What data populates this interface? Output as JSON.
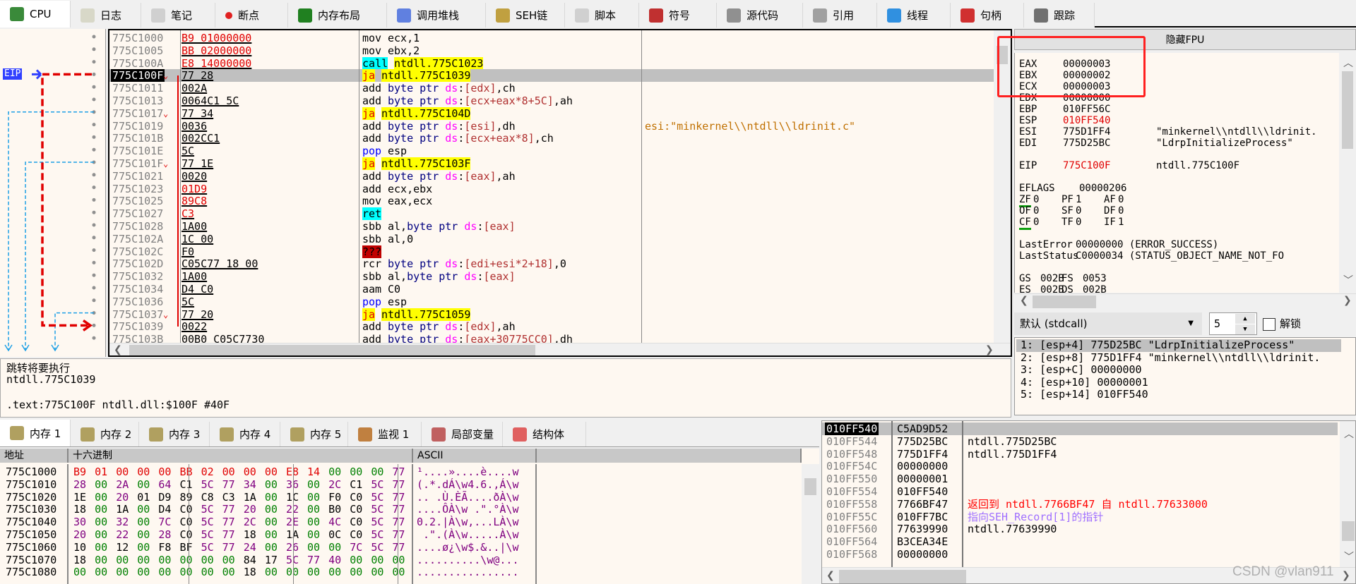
{
  "tabs": [
    {
      "label": "CPU",
      "icon": "cpu-icon",
      "active": true
    },
    {
      "label": "日志",
      "icon": "log-icon"
    },
    {
      "label": "笔记",
      "icon": "notes-icon"
    },
    {
      "label": "断点",
      "icon": "breakpoint-icon"
    },
    {
      "label": "内存布局",
      "icon": "memory-map-icon"
    },
    {
      "label": "调用堆栈",
      "icon": "call-stack-icon"
    },
    {
      "label": "SEH链",
      "icon": "seh-icon"
    },
    {
      "label": "脚本",
      "icon": "script-icon"
    },
    {
      "label": "符号",
      "icon": "symbol-icon"
    },
    {
      "label": "源代码",
      "icon": "source-icon"
    },
    {
      "label": "引用",
      "icon": "references-icon"
    },
    {
      "label": "线程",
      "icon": "threads-icon"
    },
    {
      "label": "句柄",
      "icon": "handles-icon"
    },
    {
      "label": "跟踪",
      "icon": "trace-icon"
    }
  ],
  "eip_label": "EIP",
  "colors": {
    "changed_bytes": "#e00000",
    "jump_highlight": "#ffff00",
    "call_highlight": "#00ffff",
    "highlight_box": "#ff2020",
    "eip_arrow": "#e00000",
    "jump_lines": "#1ea0e6"
  },
  "disasm": [
    {
      "addr": "775C1000",
      "bytes": "B9 01000000",
      "mnem": "mov",
      "ops": "ecx,1",
      "changed": true
    },
    {
      "addr": "775C1005",
      "bytes": "BB 02000000",
      "mnem": "mov",
      "ops": "ebx,2",
      "changed": true
    },
    {
      "addr": "775C100A",
      "bytes": "E8 14000000",
      "mnem": "call",
      "ops": "ntdll.775C1023",
      "changed": true,
      "kind": "call"
    },
    {
      "addr": "775C100F",
      "bytes": "77 28",
      "mnem": "ja",
      "ops": "ntdll.775C1039",
      "kind": "jump",
      "eip": true
    },
    {
      "addr": "775C1011",
      "bytes": "002A",
      "mnem": "add",
      "ops": "byte ptr ds:[edx],ch"
    },
    {
      "addr": "775C1013",
      "bytes": "0064C1 5C",
      "mnem": "add",
      "ops": "byte ptr ds:[ecx+eax*8+5C],ah"
    },
    {
      "addr": "775C1017",
      "bytes": "77 34",
      "mnem": "ja",
      "ops": "ntdll.775C104D",
      "kind": "jump"
    },
    {
      "addr": "775C1019",
      "bytes": "0036",
      "mnem": "add",
      "ops": "byte ptr ds:[esi],dh",
      "comment": "esi:\"minkernel\\\\ntdll\\\\ldrinit.c\""
    },
    {
      "addr": "775C101B",
      "bytes": "002CC1",
      "mnem": "add",
      "ops": "byte ptr ds:[ecx+eax*8],ch"
    },
    {
      "addr": "775C101E",
      "bytes": "5C",
      "mnem": "pop",
      "ops": "esp",
      "kind": "pop"
    },
    {
      "addr": "775C101F",
      "bytes": "77 1E",
      "mnem": "ja",
      "ops": "ntdll.775C103F",
      "kind": "jump"
    },
    {
      "addr": "775C1021",
      "bytes": "0020",
      "mnem": "add",
      "ops": "byte ptr ds:[eax],ah"
    },
    {
      "addr": "775C1023",
      "bytes": "01D9",
      "mnem": "add",
      "ops": "ecx,ebx",
      "changed": true
    },
    {
      "addr": "775C1025",
      "bytes": "89C8",
      "mnem": "mov",
      "ops": "eax,ecx",
      "changed": true
    },
    {
      "addr": "775C1027",
      "bytes": "C3",
      "mnem": "ret",
      "ops": "",
      "changed": true,
      "kind": "ret"
    },
    {
      "addr": "775C1028",
      "bytes": "1A00",
      "mnem": "sbb",
      "ops": "al,byte ptr ds:[eax]"
    },
    {
      "addr": "775C102A",
      "bytes": "1C 00",
      "mnem": "sbb",
      "ops": "al,0"
    },
    {
      "addr": "775C102C",
      "bytes": "F0",
      "mnem": "???",
      "ops": "",
      "kind": "bad"
    },
    {
      "addr": "775C102D",
      "bytes": "C05C77 18 00",
      "mnem": "rcr",
      "ops": "byte ptr ds:[edi+esi*2+18],0"
    },
    {
      "addr": "775C1032",
      "bytes": "1A00",
      "mnem": "sbb",
      "ops": "al,byte ptr ds:[eax]"
    },
    {
      "addr": "775C1034",
      "bytes": "D4 C0",
      "mnem": "aam",
      "ops": "C0"
    },
    {
      "addr": "775C1036",
      "bytes": "5C",
      "mnem": "pop",
      "ops": "esp",
      "kind": "pop"
    },
    {
      "addr": "775C1037",
      "bytes": "77 20",
      "mnem": "ja",
      "ops": "ntdll.775C1059",
      "kind": "jump"
    },
    {
      "addr": "775C1039",
      "bytes": "0022",
      "mnem": "add",
      "ops": "byte ptr ds:[edx],ah"
    },
    {
      "addr": "775C103B",
      "bytes": "00B0 C05C7730",
      "mnem": "add",
      "ops": "byte ptr ds:[eax+30775CC0],dh"
    }
  ],
  "registers": {
    "hide_fpu_label": "隐藏FPU",
    "lines": [
      {
        "name": "EAX",
        "value": "00000003"
      },
      {
        "name": "EBX",
        "value": "00000002"
      },
      {
        "name": "ECX",
        "value": "00000003"
      },
      {
        "name": "EDX",
        "value": "00000000"
      },
      {
        "name": "EBP",
        "value": "010FF56C"
      },
      {
        "name": "ESP",
        "value": "010FF540",
        "changed": true
      },
      {
        "name": "ESI",
        "value": "775D1FF4",
        "comment": "\"minkernel\\\\ntdll\\\\ldrinit."
      },
      {
        "name": "EDI",
        "value": "775D25BC",
        "comment": "\"LdrpInitializeProcess\""
      },
      {},
      {
        "name": "EIP",
        "value": "775C100F",
        "changed": true,
        "comment": "ntdll.775C100F"
      },
      {},
      {
        "name": "EFLAGS",
        "value": "00000206"
      },
      {
        "flags": [
          [
            "ZF",
            "0"
          ],
          [
            "PF",
            "1"
          ],
          [
            "AF",
            "0"
          ]
        ]
      },
      {
        "flags": [
          [
            "OF",
            "0"
          ],
          [
            "SF",
            "0"
          ],
          [
            "DF",
            "0"
          ]
        ]
      },
      {
        "flags": [
          [
            "CF",
            "0"
          ],
          [
            "TF",
            "0"
          ],
          [
            "IF",
            "1"
          ]
        ]
      },
      {},
      {
        "name": "LastError",
        "value": "00000000 (ERROR_SUCCESS)"
      },
      {
        "name": "LastStatus",
        "value": "C0000034 (STATUS_OBJECT_NAME_NOT_FO"
      },
      {},
      {
        "flags": [
          [
            "GS",
            "002B"
          ],
          [
            "FS",
            "0053"
          ]
        ]
      },
      {
        "flags": [
          [
            "ES",
            "002B"
          ],
          [
            "DS",
            "002B"
          ]
        ]
      }
    ]
  },
  "callconv": {
    "selected": "默认 (stdcall)",
    "arg_count": "5",
    "unlock_label": "解锁",
    "unlocked": false
  },
  "args": [
    "1: [esp+4] 775D25BC \"LdrpInitializeProcess\"",
    "2: [esp+8] 775D1FF4 \"minkernel\\\\ntdll\\\\ldrinit.",
    "3: [esp+C] 00000000",
    "4: [esp+10] 00000001",
    "5: [esp+14] 010FF540"
  ],
  "info": {
    "line1": "跳转将要执行",
    "line2": "ntdll.775C1039",
    "line3": ".text:775C100F ntdll.dll:$100F #40F"
  },
  "bottom_tabs": [
    {
      "label": "内存 1",
      "icon": "memory-icon",
      "active": true
    },
    {
      "label": "内存 2",
      "icon": "memory-icon"
    },
    {
      "label": "内存 3",
      "icon": "memory-icon"
    },
    {
      "label": "内存 4",
      "icon": "memory-icon"
    },
    {
      "label": "内存 5",
      "icon": "memory-icon"
    },
    {
      "label": "监视 1",
      "icon": "watch-icon"
    },
    {
      "label": "局部变量",
      "icon": "locals-icon"
    },
    {
      "label": "结构体",
      "icon": "struct-icon"
    }
  ],
  "dump": {
    "headers": {
      "addr": "地址",
      "hex": "十六进制",
      "ascii": "ASCII"
    },
    "rows": [
      {
        "addr": "775C1000",
        "hex": "B9 01 00 00 00 BB 02 00 00 00 E8 14 00 00 00 77",
        "ascii": "¹....»....è....w"
      },
      {
        "addr": "775C1010",
        "hex": "28 00 2A 00 64 C1 5C 77 34 00 36 00 2C C1 5C 77",
        "ascii": "(.*.dÁ\\w4.6.,Á\\w"
      },
      {
        "addr": "775C1020",
        "hex": "1E 00 20 01 D9 89 C8 C3 1A 00 1C 00 F0 C0 5C 77",
        "ascii": ".. .Ù.ÈÃ....ðÀ\\w"
      },
      {
        "addr": "775C1030",
        "hex": "18 00 1A 00 D4 C0 5C 77 20 00 22 00 B0 C0 5C 77",
        "ascii": "....ÔÀ\\w .\".°À\\w"
      },
      {
        "addr": "775C1040",
        "hex": "30 00 32 00 7C C0 5C 77 2C 00 2E 00 4C C0 5C 77",
        "ascii": "0.2.|À\\w,...LÀ\\w"
      },
      {
        "addr": "775C1050",
        "hex": "20 00 22 00 28 C0 5C 77 18 00 1A 00 0C C0 5C 77",
        "ascii": " .\".(À\\w.....À\\w"
      },
      {
        "addr": "775C1060",
        "hex": "10 00 12 00 F8 BF 5C 77 24 00 26 00 00 7C 5C 77",
        "ascii": "....ø¿\\w$.&..|\\w"
      },
      {
        "addr": "775C1070",
        "hex": "18 00 00 00 00 00 00 00 84 17 5C 77 40 00 00 00",
        "ascii": "..........\\w@..."
      },
      {
        "addr": "775C1080",
        "hex": "00 00 00 00 00 00 00 00 18 00 00 00 00 00 00 00",
        "ascii": "................"
      }
    ]
  },
  "stack": [
    {
      "addr": "010FF540",
      "value": "C5AD9D52",
      "selected": true
    },
    {
      "addr": "010FF544",
      "value": "775D25BC",
      "comment": "ntdll.775D25BC"
    },
    {
      "addr": "010FF548",
      "value": "775D1FF4",
      "comment": "ntdll.775D1FF4"
    },
    {
      "addr": "010FF54C",
      "value": "00000000"
    },
    {
      "addr": "010FF550",
      "value": "00000001"
    },
    {
      "addr": "010FF554",
      "value": "010FF540"
    },
    {
      "addr": "010FF558",
      "value": "7766BF47",
      "comment": "返回到 ntdll.7766BF47 自 ntdll.77633000",
      "color": "#ff0000"
    },
    {
      "addr": "010FF55C",
      "value": "010FF7BC",
      "comment": "指向SEH_Record[1]的指针",
      "color": "#a070ff"
    },
    {
      "addr": "010FF560",
      "value": "77639990",
      "comment": "ntdll.77639990"
    },
    {
      "addr": "010FF564",
      "value": "B3CEA34E"
    },
    {
      "addr": "010FF568",
      "value": "00000000"
    }
  ],
  "watermark": "CSDN @vlan911"
}
